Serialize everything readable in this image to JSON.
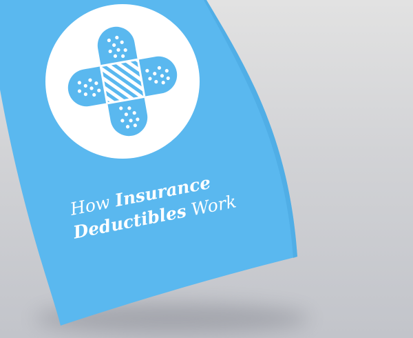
{
  "brochure": {
    "title_line1_part1": "How ",
    "title_line1_part2": "Insurance",
    "title_line2_part1": "Deductibles",
    "title_line2_part2": " Work",
    "icon": "crossed-bandages-icon",
    "colors": {
      "paper": "#5ab8ef",
      "emblem_circle": "#ffffff",
      "bandage": "#5ab8ef",
      "text": "#ffffff"
    }
  }
}
